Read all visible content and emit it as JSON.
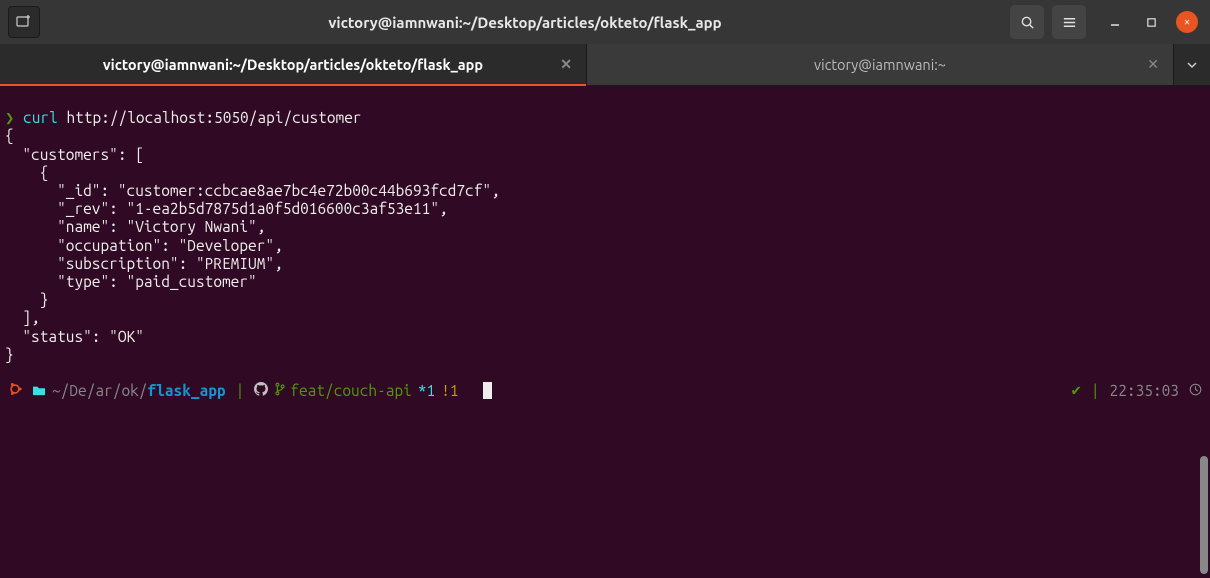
{
  "window": {
    "title": "victory@iamnwani:~/Desktop/articles/okteto/flask_app"
  },
  "tabs": [
    {
      "label": "victory@iamnwani:~/Desktop/articles/okteto/flask_app",
      "active": true
    },
    {
      "label": "victory@iamnwani:~",
      "active": false
    }
  ],
  "prompt": {
    "caret": "❯",
    "command": "curl",
    "url": "http://localhost:5050/api/customer"
  },
  "output": {
    "lines": [
      "{",
      "  \"customers\": [",
      "    {",
      "      \"_id\": \"customer:ccbcae8ae7bc4e72b00c44b693fcd7cf\", ",
      "      \"_rev\": \"1-ea2b5d7875d1a0f5d016600c3af53e11\", ",
      "      \"name\": \"Victory Nwani\", ",
      "      \"occupation\": \"Developer\", ",
      "      \"subscription\": \"PREMIUM\", ",
      "      \"type\": \"paid_customer\"",
      "    }",
      "  ], ",
      "  \"status\": \"OK\"",
      "}"
    ]
  },
  "statusline": {
    "path_prefix": "~/De/ar/ok/",
    "path_last": "flask_app",
    "branch": "feat/couch-api",
    "star": "*1",
    "bang": "!1",
    "check": "✔",
    "time": "22:35:03"
  }
}
